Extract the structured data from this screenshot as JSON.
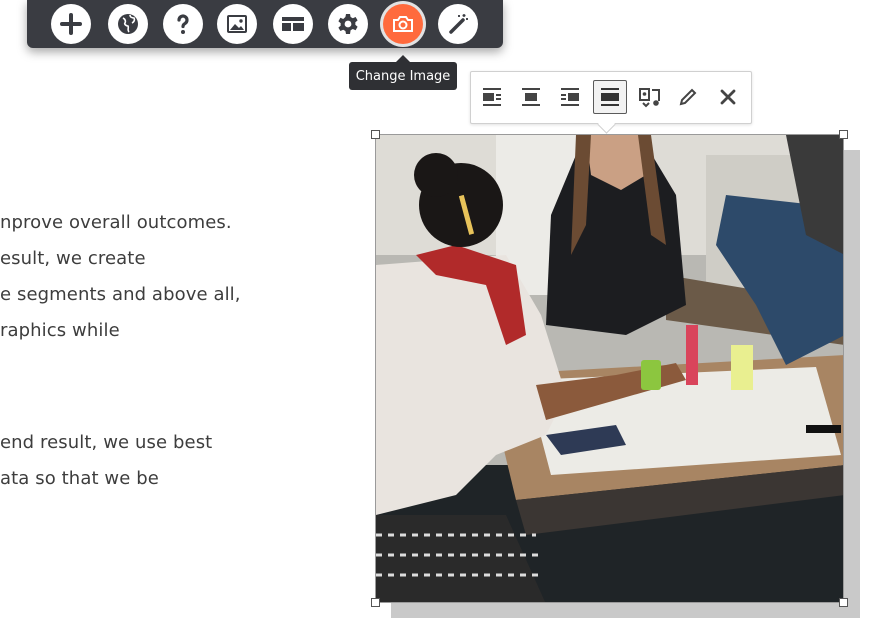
{
  "top_toolbar": {
    "buttons": [
      {
        "icon": "plus-icon",
        "label": ""
      },
      {
        "icon": "globe-icon",
        "label": ""
      },
      {
        "icon": "help-icon",
        "label": ""
      },
      {
        "icon": "image-icon",
        "label": ""
      },
      {
        "icon": "layout-icon",
        "label": ""
      },
      {
        "icon": "gear-icon",
        "label": ""
      },
      {
        "icon": "camera-icon",
        "label": "Change Image",
        "active": true
      },
      {
        "icon": "magic-wand-icon",
        "label": ""
      }
    ],
    "active_color": "#ff6a3d"
  },
  "tooltip": {
    "text": "Change Image"
  },
  "content": {
    "lines": [
      "nprove overall outcomes.",
      "esult, we create",
      "e segments and above all,",
      "raphics while",
      "end result, we use best",
      "ata so that we be"
    ]
  },
  "image_toolbar": {
    "buttons": [
      {
        "icon": "align-left-icon"
      },
      {
        "icon": "align-center-icon"
      },
      {
        "icon": "align-right-icon"
      },
      {
        "icon": "align-full-icon",
        "active": true
      },
      {
        "icon": "replace-media-icon"
      },
      {
        "icon": "pencil-icon"
      },
      {
        "icon": "close-icon"
      }
    ]
  },
  "image": {
    "description_icon": "photo-students-table"
  }
}
